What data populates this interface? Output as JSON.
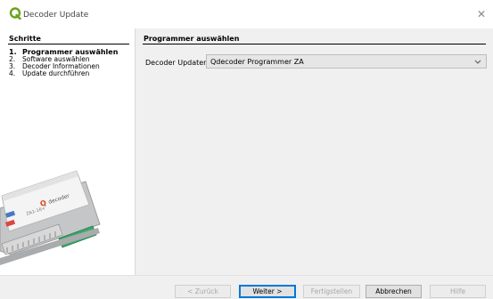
{
  "window": {
    "title": "Decoder Update",
    "close_glyph": "✕",
    "logo_color": "#6aa31a"
  },
  "sidebar": {
    "heading": "Schritte",
    "steps": [
      {
        "num": "1.",
        "label": "Programmer auswählen",
        "active": true
      },
      {
        "num": "2.",
        "label": "Software auswählen",
        "active": false
      },
      {
        "num": "3.",
        "label": "Decoder Informationen",
        "active": false
      },
      {
        "num": "4.",
        "label": "Update durchführen",
        "active": false
      }
    ]
  },
  "main": {
    "heading": "Programmer auswählen",
    "field_label": "Decoder Updater:",
    "select_value": "Qdecoder Programmer ZA",
    "chevron_icon": "chevron-down-icon"
  },
  "buttons": {
    "back": "< Zurück",
    "next": "Weiter >",
    "finish": "Fertigstellen",
    "cancel": "Abbrechen",
    "help": "Hilfe"
  }
}
